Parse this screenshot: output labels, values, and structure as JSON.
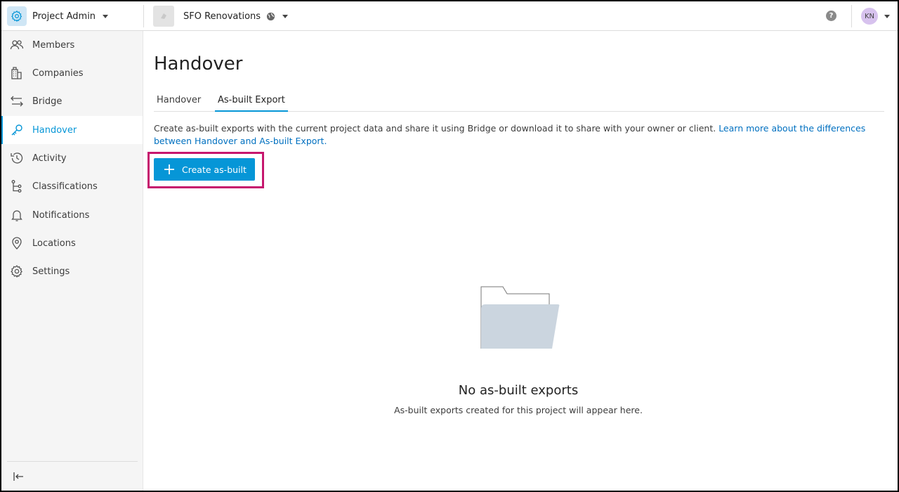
{
  "header": {
    "app_name": "Project Admin",
    "app_icon": "gear-icon",
    "project_name": "SFO Renovations",
    "project_icon": "globe-icon",
    "help_label": "?",
    "user_initials": "KN",
    "avatar_color": "#d7c2ee"
  },
  "sidebar": {
    "items": [
      {
        "label": "Members",
        "icon": "members-icon",
        "active": false
      },
      {
        "label": "Companies",
        "icon": "companies-icon",
        "active": false
      },
      {
        "label": "Bridge",
        "icon": "bridge-icon",
        "active": false
      },
      {
        "label": "Handover",
        "icon": "key-icon",
        "active": true
      },
      {
        "label": "Activity",
        "icon": "history-icon",
        "active": false
      },
      {
        "label": "Classifications",
        "icon": "hierarchy-icon",
        "active": false
      },
      {
        "label": "Notifications",
        "icon": "bell-icon",
        "active": false
      },
      {
        "label": "Locations",
        "icon": "location-pin-icon",
        "active": false
      },
      {
        "label": "Settings",
        "icon": "gear-icon",
        "active": false
      }
    ],
    "collapse_icon": "collapse-left-icon"
  },
  "main": {
    "title": "Handover",
    "tabs": [
      {
        "label": "Handover",
        "active": false
      },
      {
        "label": "As-built Export",
        "active": true
      }
    ],
    "description": "Create as-built exports with the current project data and share it using Bridge or download it to share with your owner or client. ",
    "learn_more_link": "Learn more about the differences between Handover and As-built Export.",
    "create_button_label": "Create as-built",
    "empty_state": {
      "title": "No as-built exports",
      "subtitle": "As-built exports created for this project will appear here."
    }
  },
  "colors": {
    "accent": "#0696d7",
    "link": "#0070c0",
    "highlight_box": "#c6176e"
  }
}
